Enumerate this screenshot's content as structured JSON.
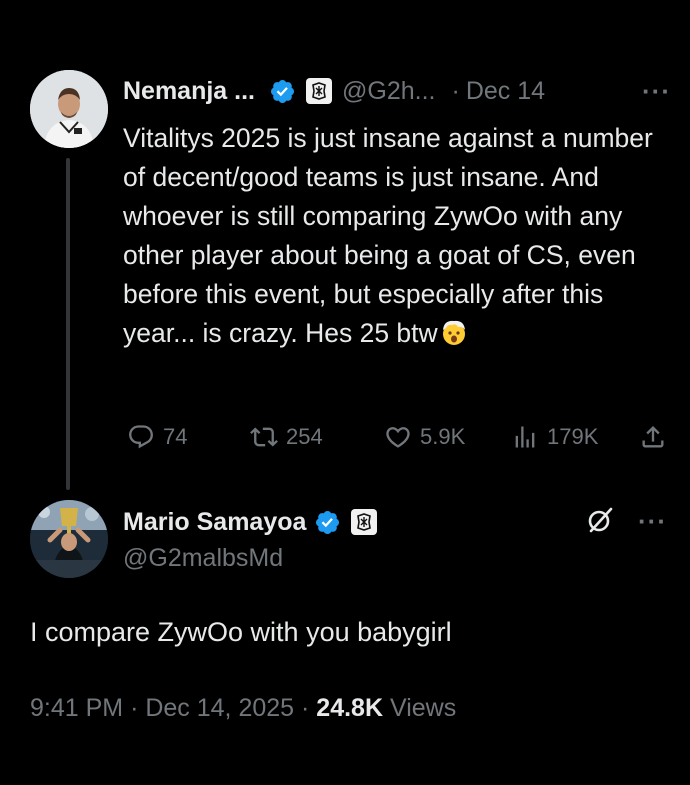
{
  "parent_tweet": {
    "author_name": "Nemanja ...",
    "handle": "@G2h...",
    "separator": "·",
    "date": "Dec 14",
    "more_label": "···",
    "text": "Vitalitys 2025 is just insane against a number of decent/good teams is just insane. And whoever is still comparing ZywOo with any other player about being a goat of CS, even before this event, but especially after this year... is crazy. Hes 25 btw",
    "emoji_icon": "exploding-head-icon",
    "stats": {
      "replies": "74",
      "reposts": "254",
      "likes": "5.9K",
      "views": "179K"
    }
  },
  "reply_tweet": {
    "author_name": "Mario Samayoa",
    "handle": "@G2malbsMd",
    "more_label": "···",
    "text": "I compare ZywOo with you babygirl",
    "time": "9:41 PM",
    "separator": "·",
    "date": "Dec 14, 2025",
    "views_count": "24.8K",
    "views_label": "Views"
  },
  "colors": {
    "background": "#000000",
    "text_primary": "#e7e9ea",
    "text_secondary": "#71767b",
    "verified_blue": "#1d9bf0"
  }
}
